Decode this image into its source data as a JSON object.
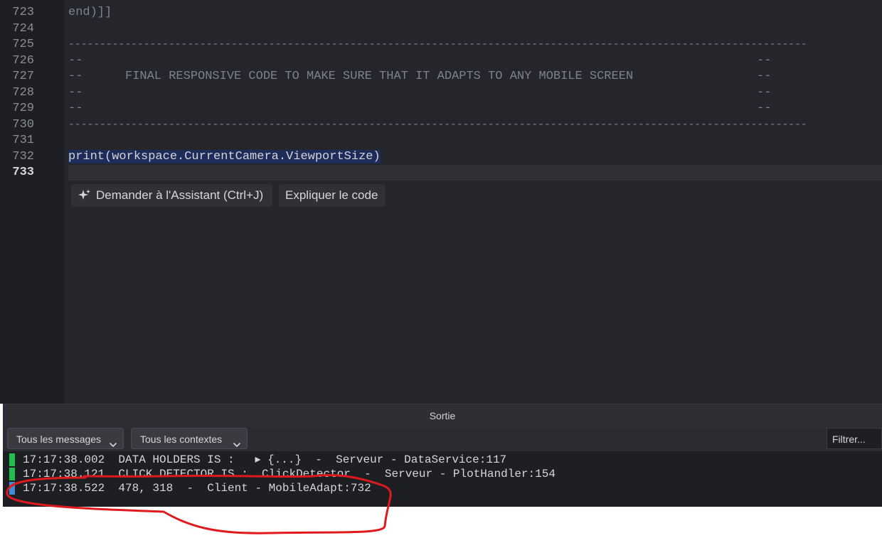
{
  "editor": {
    "line_numbers": [
      "723",
      "724",
      "725",
      "726",
      "727",
      "728",
      "729",
      "730",
      "731",
      "732",
      "733"
    ],
    "current_line": "733",
    "lines": {
      "l723": "end)]]",
      "l725": "-----------------------------------------------------------------------------------------------------------------------",
      "l726": "--                                                                                    --",
      "l727": "--     FINAL RESPONSIVE CODE TO MAKE SURE THAT IT ADAPTS TO ANY MOBILE SCREEN         --",
      "l728": "--                                                                                    --",
      "l729": "--                                                                                    --",
      "l730": "-----------------------------------------------------------------------------------------------------------------------",
      "l732": "print(workspace.CurrentCamera.ViewportSize)"
    },
    "ai_buttons": {
      "ask_label": "Demander à l'Assistant (Ctrl+J)",
      "explain_label": "Expliquer le code"
    }
  },
  "output_panel": {
    "title": "Sortie",
    "filters": {
      "messages": "Tous les messages",
      "contexts": "Tous les contextes",
      "search_placeholder": "Filtrer..."
    },
    "logs": [
      {
        "time": "17:17:38.002",
        "text": "DATA HOLDERS IS :   ▸ {...}  -  Serveur - DataService:117",
        "color": "#1fbf4e"
      },
      {
        "time": "17:17:38.121",
        "text": "CLICK DETECTOR IS :  ClickDetector  -  Serveur - PlotHandler:154",
        "color": "#1fbf4e"
      },
      {
        "time": "17:17:38.522",
        "text": "478, 318  -  Client - MobileAdapt:732",
        "color": "#3b8fd6"
      }
    ]
  },
  "colors": {
    "annotation": "#e0191d"
  },
  "icons": [
    "sparkle-icon",
    "chevron-down-icon"
  ]
}
